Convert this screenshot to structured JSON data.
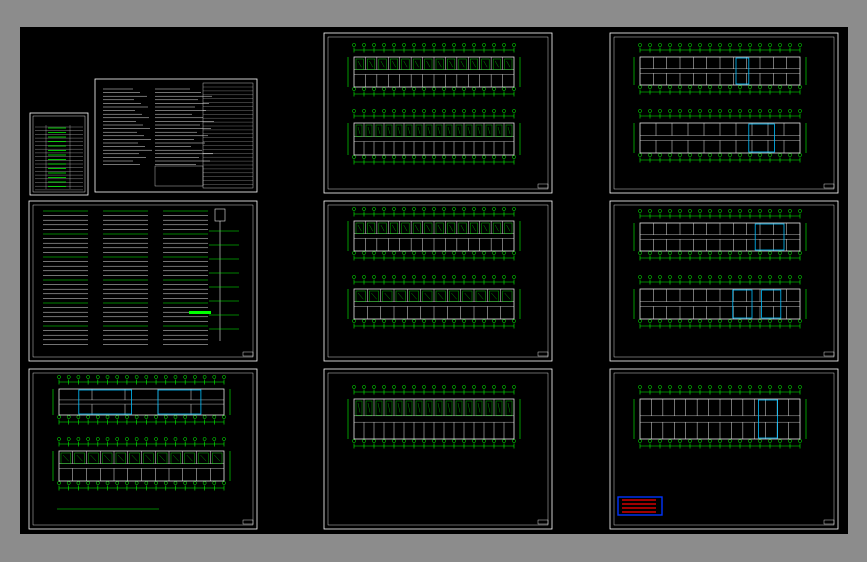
{
  "viewer": {
    "background_color": "#8c8c8c",
    "canvas_color": "#000000"
  },
  "colors": {
    "sheet_border": "#ffffff",
    "dimension": "#00ff00",
    "wall": "#e6e6e6",
    "highlight_zone": "#00bfff",
    "stamp_red": "#ff0000",
    "stamp_blue": "#0033ff"
  },
  "sheets": [
    {
      "id": "cover-index",
      "kind": "table"
    },
    {
      "id": "design-notes",
      "kind": "notes"
    },
    {
      "id": "plan-sheet-2",
      "kind": "plan-pair"
    },
    {
      "id": "plan-sheet-3",
      "kind": "plan-pair"
    },
    {
      "id": "system-diagram",
      "kind": "diagram"
    },
    {
      "id": "plan-sheet-5",
      "kind": "plan-pair"
    },
    {
      "id": "plan-sheet-6",
      "kind": "plan-pair"
    },
    {
      "id": "ground-floor-plan",
      "kind": "plan-pair"
    },
    {
      "id": "plan-sheet-8",
      "kind": "plan-single"
    },
    {
      "id": "plan-sheet-9",
      "kind": "plan-single-stamp"
    }
  ],
  "stamp": {
    "line1": "",
    "line2": ""
  }
}
